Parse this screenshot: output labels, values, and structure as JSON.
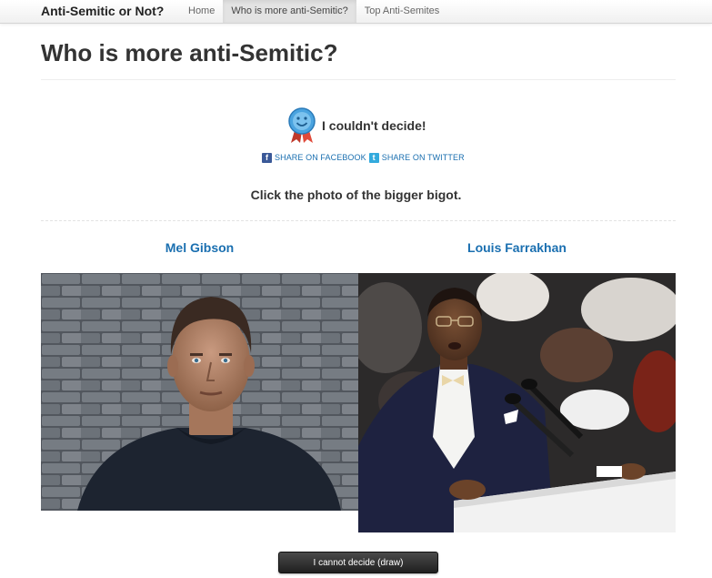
{
  "navbar": {
    "brand": "Anti-Semitic or Not?",
    "items": [
      {
        "label": "Home",
        "active": false
      },
      {
        "label": "Who is more anti-Semitic?",
        "active": true
      },
      {
        "label": "Top Anti-Semites",
        "active": false
      }
    ]
  },
  "page": {
    "title": "Who is more anti-Semitic?"
  },
  "result": {
    "icon": "award-ribbon-icon",
    "text": "I couldn't decide!"
  },
  "share": {
    "facebook_label": "SHARE ON FACEBOOK",
    "twitter_label": "SHARE ON TWITTER"
  },
  "instruction": "Click the photo of the bigger bigot.",
  "candidates": [
    {
      "name": "Mel Gibson"
    },
    {
      "name": "Louis Farrakhan"
    }
  ],
  "draw_button": "I cannot decide (draw)",
  "colors": {
    "link": "#1a6fb0",
    "button": "#2b2b2b"
  }
}
